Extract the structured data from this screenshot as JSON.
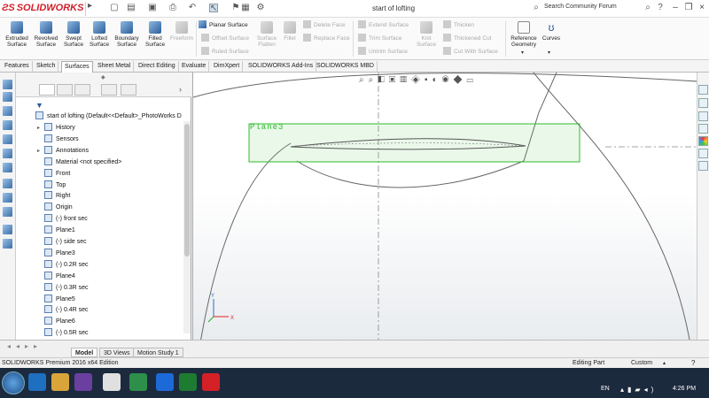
{
  "app": {
    "brand": "SOLIDWORKS",
    "document_title": "start of lofting",
    "search_placeholder": "Search Community Forum"
  },
  "ribbon": {
    "big_buttons": [
      {
        "label": "Extruded\nSurface",
        "icon": "extruded-surface-icon",
        "enabled": true
      },
      {
        "label": "Revolved\nSurface",
        "icon": "revolved-surface-icon",
        "enabled": true
      },
      {
        "label": "Swept\nSurface",
        "icon": "swept-surface-icon",
        "enabled": true
      },
      {
        "label": "Lofted\nSurface",
        "icon": "lofted-surface-icon",
        "enabled": true
      },
      {
        "label": "Boundary\nSurface",
        "icon": "boundary-surface-icon",
        "enabled": true
      },
      {
        "label": "Filled\nSurface",
        "icon": "filled-surface-icon",
        "enabled": true
      },
      {
        "label": "Freeform",
        "icon": "freeform-icon",
        "enabled": false
      }
    ],
    "col1": [
      {
        "label": "Planar Surface",
        "enabled": true
      },
      {
        "label": "Offset Surface",
        "enabled": false
      },
      {
        "label": "Ruled Surface",
        "enabled": false
      }
    ],
    "surface_flatten": "Surface\nFlatten",
    "fillet": "Fillet",
    "col2": [
      {
        "label": "Delete Face",
        "enabled": false
      },
      {
        "label": "Replace Face",
        "enabled": false
      }
    ],
    "col3": [
      {
        "label": "Extend Surface",
        "enabled": false
      },
      {
        "label": "Trim Surface",
        "enabled": false
      },
      {
        "label": "Untrim Surface",
        "enabled": false
      }
    ],
    "knit": "Knit\nSurface",
    "col4": [
      {
        "label": "Thicken",
        "enabled": false
      },
      {
        "label": "Thickened Cut",
        "enabled": false
      },
      {
        "label": "Cut With Surface",
        "enabled": false
      }
    ],
    "reference_geometry": "Reference\nGeometry",
    "curves": "Curves"
  },
  "tabs": [
    "Features",
    "Sketch",
    "Surfaces",
    "Sheet Metal",
    "Direct Editing",
    "Evaluate",
    "DimXpert",
    "SOLIDWORKS Add-Ins",
    "SOLIDWORKS MBD"
  ],
  "active_tab": "Surfaces",
  "tree": {
    "root": "start of lofting  (Default<<Default>_PhotoWorks D",
    "nodes": [
      {
        "label": "History",
        "expandable": true
      },
      {
        "label": "Sensors",
        "expandable": false
      },
      {
        "label": "Annotations",
        "expandable": true
      },
      {
        "label": "Material <not specified>",
        "expandable": false
      },
      {
        "label": "Front",
        "expandable": false
      },
      {
        "label": "Top",
        "expandable": false
      },
      {
        "label": "Right",
        "expandable": false
      },
      {
        "label": "Origin",
        "expandable": false
      },
      {
        "label": "(-) front sec",
        "expandable": false
      },
      {
        "label": "Plane1",
        "expandable": false
      },
      {
        "label": "(-) side sec",
        "expandable": false
      },
      {
        "label": "Plane3",
        "expandable": false
      },
      {
        "label": "(-) 0.2R sec",
        "expandable": false
      },
      {
        "label": "Plane4",
        "expandable": false
      },
      {
        "label": "(-) 0.3R sec",
        "expandable": false
      },
      {
        "label": "Plane5",
        "expandable": false
      },
      {
        "label": "(-) 0.4R sec",
        "expandable": false
      },
      {
        "label": "Plane6",
        "expandable": false
      },
      {
        "label": "(-) 0.5R sec",
        "expandable": false
      }
    ]
  },
  "viewport": {
    "plane_label": "Plane3"
  },
  "bottom_tabs": [
    "Model",
    "3D Views",
    "Motion Study 1"
  ],
  "active_bottom_tab": "Model",
  "status": {
    "left": "SOLIDWORKS Premium 2016 x64 Edition",
    "mode": "Editing Part",
    "units": "Custom"
  },
  "taskbar": {
    "lang": "EN",
    "time": "4:26 PM"
  }
}
